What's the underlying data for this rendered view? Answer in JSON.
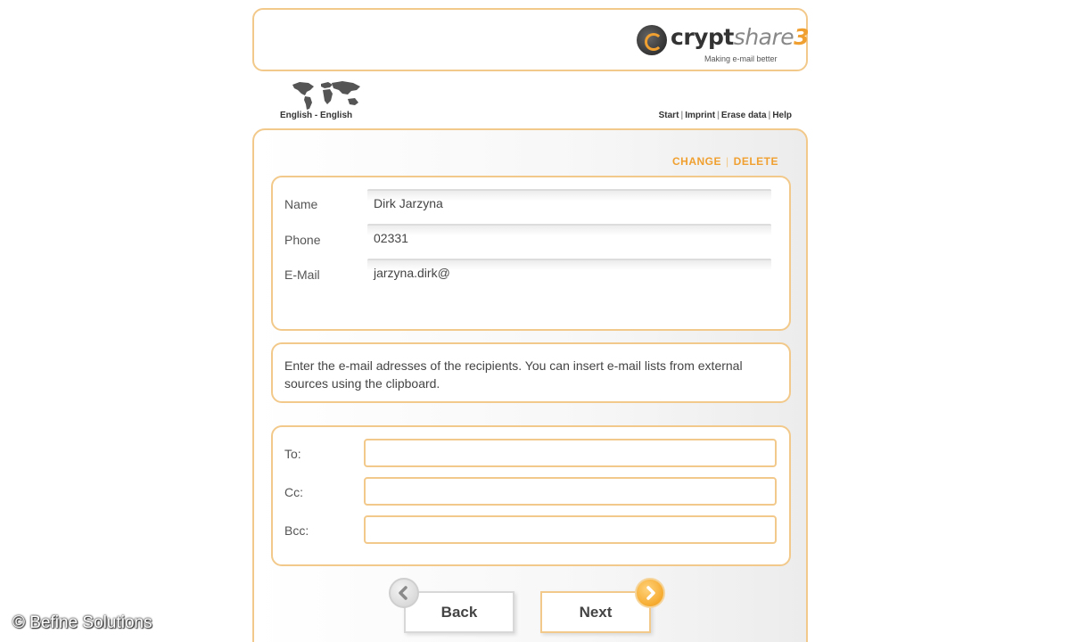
{
  "header": {
    "logo": {
      "text_crypt": "crypt",
      "text_share": "share",
      "text_version": "3",
      "tagline": "Making e-mail better"
    }
  },
  "language": {
    "label": "English - English",
    "icon": "world-map-icon"
  },
  "top_links": [
    "Start",
    "Imprint",
    "Erase data",
    "Help"
  ],
  "actions": {
    "change": "CHANGE",
    "delete": "DELETE"
  },
  "sender": {
    "name_label": "Name",
    "name_value": "Dirk Jarzyna",
    "phone_label": "Phone",
    "phone_value": "02331",
    "email_label": "E-Mail",
    "email_value": "jarzyna.dirk@"
  },
  "info": {
    "text": "Enter the e-mail adresses of the recipients. You can insert e-mail lists from external sources using the clipboard."
  },
  "recipients": {
    "to_label": "To:",
    "cc_label": "Cc:",
    "bcc_label": "Bcc:"
  },
  "buttons": {
    "back": "Back",
    "next": "Next",
    "back_icon": "chevron-left-icon",
    "next_icon": "chevron-right-icon"
  },
  "colors": {
    "accent": "#f0a030",
    "border": "#f2c98a"
  },
  "copyright": "© Befine Solutions"
}
